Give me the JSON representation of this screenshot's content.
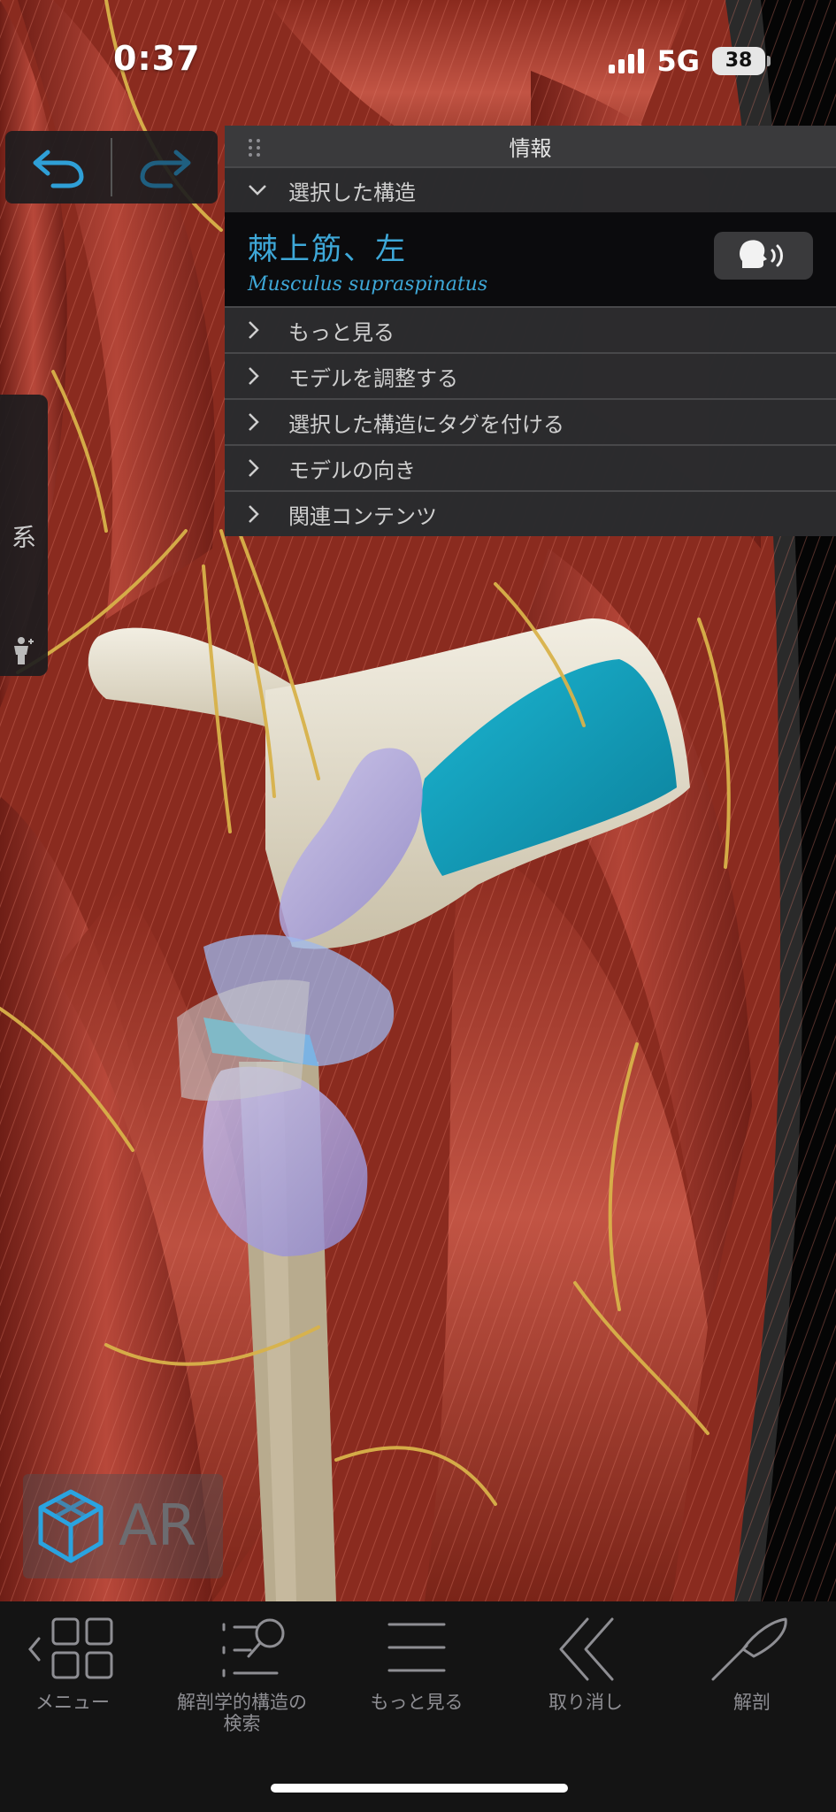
{
  "status": {
    "time": "0:37",
    "network": "5G",
    "battery": "38"
  },
  "panel": {
    "title": "情報",
    "selected_section": "選択した構造",
    "structure_name": "棘上筋、左",
    "structure_latin": "Musculus supraspinatus",
    "items": [
      {
        "label": "もっと見る"
      },
      {
        "label": "モデルを調整する"
      },
      {
        "label": "選択した構造にタグを付ける"
      },
      {
        "label": "モデルの向き"
      },
      {
        "label": "関連コンテンツ"
      }
    ]
  },
  "side_tab": {
    "label": "系"
  },
  "ar": {
    "label": "AR"
  },
  "toolbar": {
    "menu": "メニュー",
    "search_line1": "解剖学的構造の",
    "search_line2": "検索",
    "more": "もっと見る",
    "undo": "取り消し",
    "dissect": "解剖"
  },
  "colors": {
    "accent": "#3ea8d8",
    "muscle": "#a83a2c",
    "nerve": "#d8b24a",
    "bone": "#e8e2d2",
    "highlight": "#18a6c4"
  }
}
